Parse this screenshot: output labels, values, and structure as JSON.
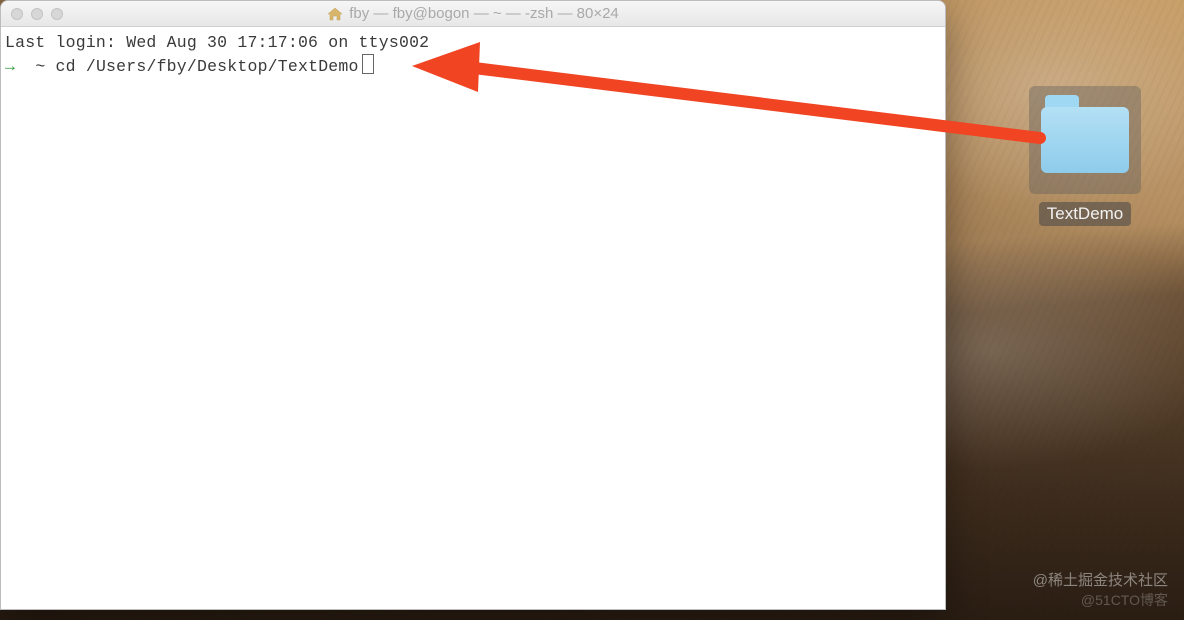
{
  "terminal": {
    "title": "fby — fby@bogon — ~ — -zsh — 80×24",
    "last_login_line": "Last login: Wed Aug 30 17:17:06 on ttys002",
    "prompt_arrow": "→",
    "prompt_cwd": "~",
    "command": "cd /Users/fby/Desktop/TextDemo"
  },
  "desktop": {
    "folder_label": "TextDemo"
  },
  "annotation": {
    "arrow_color": "#f04423"
  },
  "watermarks": {
    "line1": "@稀土掘金技术社区",
    "line2": "@51CTO博客"
  }
}
